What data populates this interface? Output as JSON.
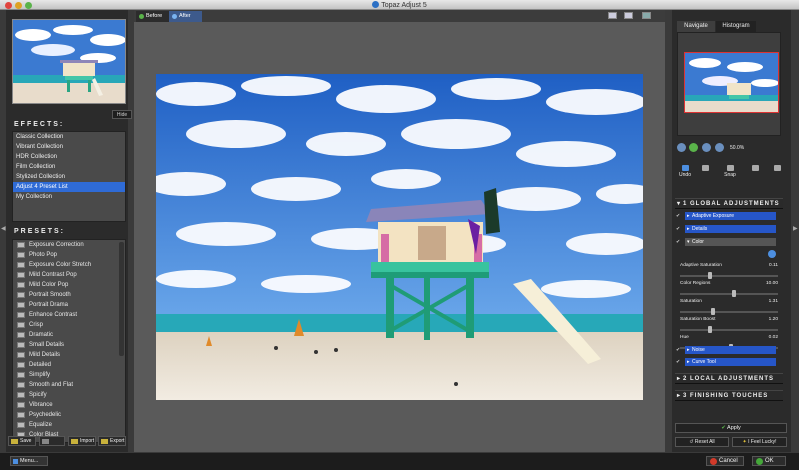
{
  "window": {
    "title": "Topaz Adjust 5"
  },
  "left": {
    "hide_label": "Hide",
    "effects_label": "EFFECTS:",
    "effects": [
      {
        "label": "Classic Collection",
        "selected": false
      },
      {
        "label": "Vibrant Collection",
        "selected": false
      },
      {
        "label": "HDR Collection",
        "selected": false
      },
      {
        "label": "Film Collection",
        "selected": false
      },
      {
        "label": "Stylized Collection",
        "selected": false
      },
      {
        "label": "Adjust 4 Preset List",
        "selected": true
      },
      {
        "label": "My Collection",
        "selected": false
      }
    ],
    "presets_label": "PRESETS:",
    "presets": [
      "Exposure Correction",
      "Photo Pop",
      "Exposure Color Stretch",
      "Mild Contrast Pop",
      "Mild Color Pop",
      "Portrait Smooth",
      "Portrait Drama",
      "Enhance Contrast",
      "Crisp",
      "Dramatic",
      "Small Details",
      "Mild Details",
      "Detailed",
      "Simplify",
      "Smooth and Flat",
      "Spicify",
      "Vibrance",
      "Psychedelic",
      "Equalize",
      "Color Blast"
    ],
    "tools": {
      "save": "Save",
      "import": "Import",
      "export": "Export"
    }
  },
  "center": {
    "tabs": {
      "before": "Before",
      "after": "After"
    }
  },
  "right": {
    "tabs": {
      "navigate": "Navigate",
      "histogram": "Histogram"
    },
    "zoom": "50.0%",
    "actions": {
      "undo": "Undo",
      "snap": "Snap"
    },
    "global_header": "1 GLOBAL ADJUSTMENTS",
    "items": {
      "adaptive_exposure": "Adaptive Exposure",
      "details": "Details",
      "color": "Color",
      "noise": "Noise",
      "curve_tool": "Curve Tool"
    },
    "sliders": [
      {
        "label": "Adaptive Saturation",
        "value": "0.11",
        "pos": 0.3
      },
      {
        "label": "Color Regions",
        "value": "10.00",
        "pos": 0.55
      },
      {
        "label": "Saturation",
        "value": "1.31",
        "pos": 0.33
      },
      {
        "label": "Saturation Boost",
        "value": "1.20",
        "pos": 0.3
      },
      {
        "label": "Hue",
        "value": "0.02",
        "pos": 0.52
      }
    ],
    "local_header": "2 LOCAL ADJUSTMENTS",
    "finishing_header": "3 FINISHING TOUCHES",
    "apply": "Apply",
    "reset": "Reset All",
    "lucky": "I Feel Lucky!"
  },
  "bottom": {
    "menu": "Menu...",
    "cancel": "Cancel",
    "ok": "OK"
  },
  "colors": {
    "accent": "#2f6bd6",
    "panel": "#2b2b2b",
    "canvas": "#5a5a5a"
  }
}
